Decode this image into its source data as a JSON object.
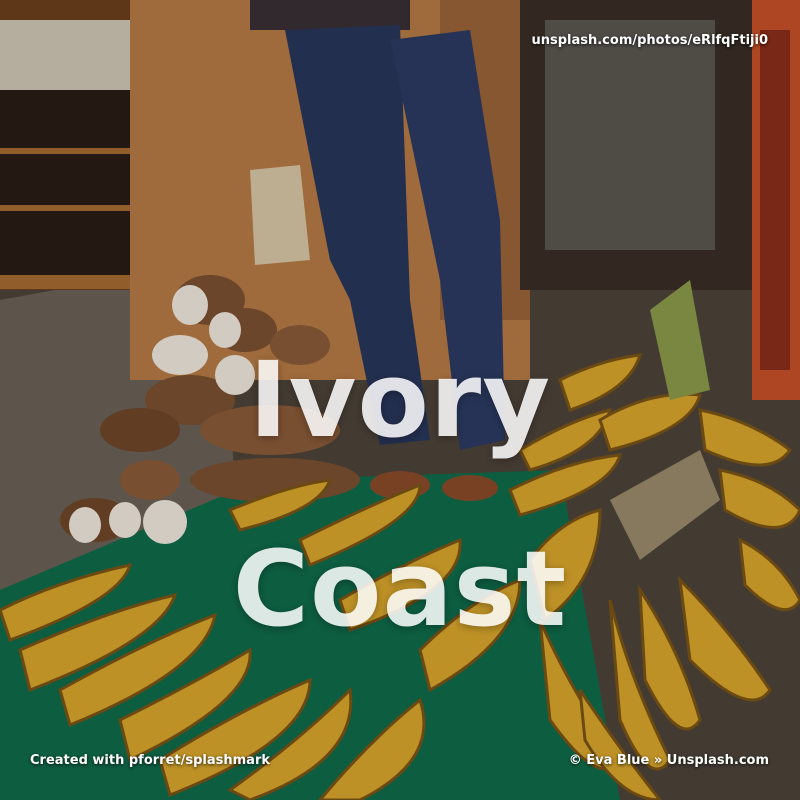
{
  "photo": {
    "title_lines": [
      "Ivory",
      "Coast"
    ],
    "source_url": "unsplash.com/photos/eRlfqFtiji0",
    "created_with": "Created with pforret/splashmark",
    "attribution": "© Eva Blue » Unsplash.com"
  },
  "colors": {
    "floor": "#5b5248",
    "tarp": "#0f6a4a",
    "plantain": "#d8a52c",
    "plantain_dark": "#7a5416",
    "cassava_skin": "#7a5030",
    "cassava_flesh": "#efe8dc",
    "wood_wall": "#b57a45",
    "jeans": "#28365a",
    "cloth": "#c6502a"
  }
}
